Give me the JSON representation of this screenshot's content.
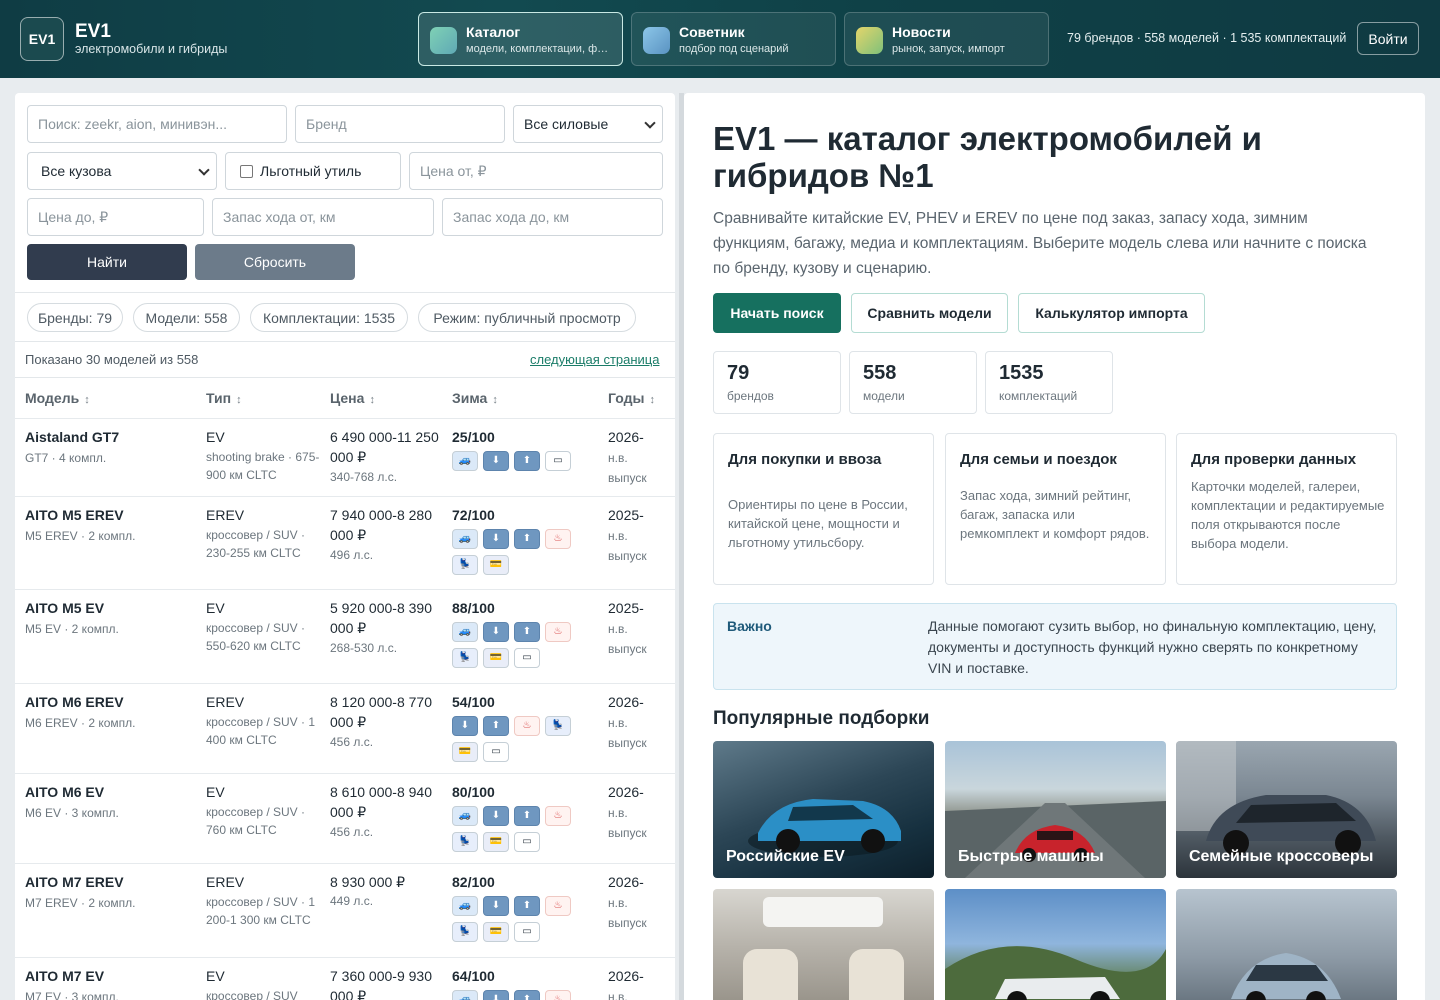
{
  "header": {
    "logo": "EV1",
    "brand": "EV1",
    "tagline": "электромобили и гибриды",
    "tabs": [
      {
        "title": "Каталог",
        "subtitle": "модели, комплектации, фото",
        "active": true
      },
      {
        "title": "Советник",
        "subtitle": "подбор под сценарий",
        "active": false
      },
      {
        "title": "Новости",
        "subtitle": "рынок, запуск, импорт",
        "active": false
      }
    ],
    "stats": "79 брендов · 558 моделей · 1 535 комплектаций",
    "login": "Войти"
  },
  "filters": {
    "search_placeholder": "Поиск: zeekr, aion, минивэн...",
    "brand_placeholder": "Бренд",
    "powertrain": "Все силовые",
    "body": "Все кузова",
    "util_label": "Льготный утиль",
    "price_from": "Цена от, ₽",
    "price_to": "Цена до, ₽",
    "range_from": "Запас хода от, км",
    "range_to": "Запас хода до, км",
    "find": "Найти",
    "reset": "Сбросить"
  },
  "pills": [
    "Бренды: 79",
    "Модели: 558",
    "Комплектации: 1535",
    "Режим: публичный просмотр"
  ],
  "list": {
    "shown": "Показано 30 моделей из 558",
    "next": "следующая страница",
    "sort_glyph": "↕",
    "columns": [
      "Модель",
      "Тип",
      "Цена",
      "Зима",
      "Годы"
    ]
  },
  "rows": [
    {
      "name": "Aistaland GT7",
      "sub": "GT7 · 4 компл.",
      "type": "EV",
      "tdesc": "shooting brake · 675-900 км CLTC",
      "price": "6 490 000-11 250 000 ₽",
      "hp": "340-768 л.с.",
      "score": "25/100",
      "year": "2026-",
      "ysub": "н.в. выпуск",
      "icons": [
        "car",
        "down",
        "up",
        "bat"
      ]
    },
    {
      "name": "AITO M5 EREV",
      "sub": "M5 EREV · 2 компл.",
      "type": "EREV",
      "tdesc": "кроссовер / SUV · 230-255 км CLTC",
      "price": "7 940 000-8 280 000 ₽",
      "hp": "496 л.с.",
      "score": "72/100",
      "year": "2025-",
      "ysub": "н.в. выпуск",
      "icons": [
        "car",
        "down",
        "up",
        "heat",
        "seat",
        "card"
      ]
    },
    {
      "name": "AITO M5 EV",
      "sub": "M5 EV · 2 компл.",
      "type": "EV",
      "tdesc": "кроссовер / SUV · 550-620 км CLTC",
      "price": "5 920 000-8 390 000 ₽",
      "hp": "268-530 л.с.",
      "score": "88/100",
      "year": "2025-",
      "ysub": "н.в. выпуск",
      "icons": [
        "car",
        "down",
        "up",
        "heat",
        "seat",
        "card",
        "bat"
      ]
    },
    {
      "name": "AITO M6 EREV",
      "sub": "M6 EREV · 2 компл.",
      "type": "EREV",
      "tdesc": "кроссовер / SUV · 1 400 км CLTC",
      "price": "8 120 000-8 770 000 ₽",
      "hp": "456 л.с.",
      "score": "54/100",
      "year": "2026-",
      "ysub": "н.в. выпуск",
      "icons": [
        "down",
        "up",
        "heat",
        "seat",
        "card",
        "bat"
      ]
    },
    {
      "name": "AITO M6 EV",
      "sub": "M6 EV · 3 компл.",
      "type": "EV",
      "tdesc": "кроссовер / SUV · 760 км CLTC",
      "price": "8 610 000-8 940 000 ₽",
      "hp": "456 л.с.",
      "score": "80/100",
      "year": "2026-",
      "ysub": "н.в. выпуск",
      "icons": [
        "car",
        "down",
        "up",
        "heat",
        "seat",
        "card",
        "bat"
      ]
    },
    {
      "name": "AITO M7 EREV",
      "sub": "M7 EREV · 2 компл.",
      "type": "EREV",
      "tdesc": "кроссовер / SUV · 1 200-1 300 км CLTC",
      "price": "8 930 000 ₽",
      "hp": "449 л.с.",
      "score": "82/100",
      "year": "2026-",
      "ysub": "н.в. выпуск",
      "icons": [
        "car",
        "down",
        "up",
        "heat",
        "seat",
        "card",
        "bat"
      ]
    },
    {
      "name": "AITO M7 EV",
      "sub": "M7 EV · 3 компл.",
      "type": "EV",
      "tdesc": "кроссовер / SUV",
      "price": "7 360 000-9 930 000 ₽",
      "hp": "",
      "score": "64/100",
      "year": "2026-",
      "ysub": "н.в.",
      "icons": [
        "car",
        "down",
        "up",
        "heat"
      ]
    }
  ],
  "hero": {
    "title": "EV1 — каталог электромобилей и гибридов №1",
    "desc": "Сравнивайте китайские EV, PHEV и EREV по цене под заказ, запасу хода, зимним функциям, багажу, медиа и комплектациям. Выберите модель слева или начните с поиска по бренду, кузову и сценарию.",
    "cta": [
      "Начать поиск",
      "Сравнить модели",
      "Калькулятор импорта"
    ]
  },
  "stats": [
    {
      "num": "79",
      "label": "брендов"
    },
    {
      "num": "558",
      "label": "модели"
    },
    {
      "num": "1535",
      "label": "комплектаций"
    }
  ],
  "cards": [
    {
      "title": "Для покупки и ввоза",
      "text": "Ориентиры по цене в России, китайской цене, мощности и льготному утильсбору."
    },
    {
      "title": "Для семьи и поездок",
      "text": "Запас хода, зимний рейтинг, багаж, запаска или ремкомплект и комфорт рядов."
    },
    {
      "title": "Для проверки данных",
      "text": "Карточки моделей, галереи, комплектации и редактируемые поля открываются после выбора модели."
    }
  ],
  "notice": {
    "label": "Важно",
    "text": "Данные помогают сузить выбор, но финальную комплектацию, цену, документы и доступность функций нужно сверять по конкретному VIN и поставке."
  },
  "popular": {
    "title": "Популярные подборки",
    "tiles": [
      "Российские EV",
      "Быстрые машины",
      "Семейные кроссоверы",
      "",
      "",
      ""
    ]
  },
  "icon_glyphs": {
    "car": "🚙",
    "down": "⬇",
    "up": "⬆",
    "heat": "♨",
    "seat": "💺",
    "card": "💳",
    "bat": "▭"
  },
  "colors": {
    "accent": "#16705f",
    "header": "#0f3c44",
    "dark_button": "#313c4e"
  }
}
